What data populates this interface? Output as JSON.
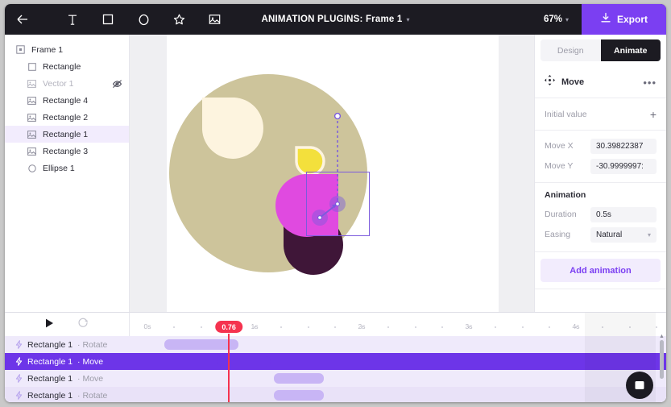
{
  "topbar": {
    "back_icon": "arrow-left-icon",
    "tools": [
      {
        "name": "text-tool",
        "icon": "text-icon",
        "label": "T"
      },
      {
        "name": "rectangle-tool",
        "icon": "square-icon",
        "label": "Rectangle"
      },
      {
        "name": "ellipse-tool",
        "icon": "circle-icon",
        "label": "Ellipse"
      },
      {
        "name": "star-tool",
        "icon": "star-icon",
        "label": "Star"
      },
      {
        "name": "image-tool",
        "icon": "image-icon",
        "label": "Image"
      }
    ],
    "title": "ANIMATION PLUGINS: Frame 1",
    "title_caret": "▾",
    "zoom": "67%",
    "zoom_caret": "▾",
    "export_label": "Export",
    "export_icon": "download-icon",
    "export_color": "#7b3ff2",
    "background": "#1c1b22"
  },
  "layers": {
    "items": [
      {
        "label": "Frame 1",
        "icon": "frame-icon",
        "indent": 0,
        "selected": false,
        "dimmed": false,
        "hidden_icon": null
      },
      {
        "label": "Rectangle",
        "icon": "square-icon",
        "indent": 1,
        "selected": false,
        "dimmed": false,
        "hidden_icon": null
      },
      {
        "label": "Vector 1",
        "icon": "vector-icon",
        "indent": 1,
        "selected": false,
        "dimmed": true,
        "hidden_icon": "eye-off-icon"
      },
      {
        "label": "Rectangle 4",
        "icon": "vector-icon",
        "indent": 1,
        "selected": false,
        "dimmed": false,
        "hidden_icon": null
      },
      {
        "label": "Rectangle 2",
        "icon": "vector-icon",
        "indent": 1,
        "selected": false,
        "dimmed": false,
        "hidden_icon": null
      },
      {
        "label": "Rectangle 1",
        "icon": "vector-icon",
        "indent": 1,
        "selected": true,
        "dimmed": false,
        "hidden_icon": null
      },
      {
        "label": "Rectangle 3",
        "icon": "vector-icon",
        "indent": 1,
        "selected": false,
        "dimmed": false,
        "hidden_icon": null
      },
      {
        "label": "Ellipse 1",
        "icon": "circle-icon",
        "indent": 1,
        "selected": false,
        "dimmed": false,
        "hidden_icon": null
      }
    ],
    "selected_highlight": "#f2ecfd"
  },
  "canvas": {
    "background": "#ffffff",
    "gutter": "#efeff2",
    "shapes": {
      "big_circle_color": "#cdc49b",
      "cream_blob_color": "#fdf4df",
      "yellow_blob_color": "#f3e03c",
      "yellow_blob_stroke": "#fdf4df",
      "magenta_blob_color": "#e04ae0",
      "dark_plum_color": "#3f1638"
    },
    "selection": {
      "stroke": "#7b5bdd",
      "motion_path_color": "#7b5bdd",
      "handle_fill": "#ffffff"
    }
  },
  "right_panel": {
    "tabs": [
      {
        "label": "Design",
        "active": false
      },
      {
        "label": "Animate",
        "active": true
      }
    ],
    "animation_header": {
      "icon": "move-icon",
      "title": "Move",
      "menu_icon": "ellipsis-icon",
      "menu_label": "•••"
    },
    "initial_value": {
      "label": "Initial value",
      "add_icon": "plus-icon",
      "add_label": "+"
    },
    "properties": [
      {
        "key": "Move X",
        "value": "30.39822387"
      },
      {
        "key": "Move Y",
        "value": "-30.9999997:"
      }
    ],
    "animation_section": {
      "title": "Animation",
      "rows": [
        {
          "key": "Duration",
          "value": "0.5s",
          "type": "input"
        },
        {
          "key": "Easing",
          "value": "Natural",
          "type": "select",
          "caret": "▾"
        }
      ]
    },
    "add_animation_label": "Add animation",
    "accent": "#7b3ff2"
  },
  "timeline": {
    "controls": {
      "play_icon": "play-icon",
      "loop_icon": "loop-icon"
    },
    "ruler": {
      "labels": [
        "0s",
        "1s",
        "2s",
        "3s",
        "4s"
      ],
      "unit_suffix": "s",
      "seconds": [
        0,
        1,
        2,
        3,
        4
      ],
      "minor_ticks_per_second": 4
    },
    "playhead": {
      "value": "0.76",
      "time_seconds": 0.76,
      "color": "#f5334f"
    },
    "tracks": [
      {
        "name": "Rectangle 1",
        "property": "Rotate",
        "active": false,
        "clip_start": 0.16,
        "clip_end": 0.85
      },
      {
        "name": "Rectangle 1",
        "property": "Move",
        "active": true,
        "clip_start": 0.65,
        "clip_end": 1.15
      },
      {
        "name": "Rectangle 1",
        "property": "Move",
        "active": false,
        "clip_start": 1.18,
        "clip_end": 1.65
      },
      {
        "name": "Rectangle 1",
        "property": "Rotate",
        "active": false,
        "clip_start": 1.18,
        "clip_end": 1.65
      }
    ],
    "clip_color": "#c8b5f5",
    "clip_active_color": "#6d35e8",
    "row_icon": "bolt-icon",
    "scrollbar": {
      "name": "vertical-scrollbar",
      "up_arrow": "▲"
    },
    "chat_icon": "chat-bubble-icon"
  }
}
